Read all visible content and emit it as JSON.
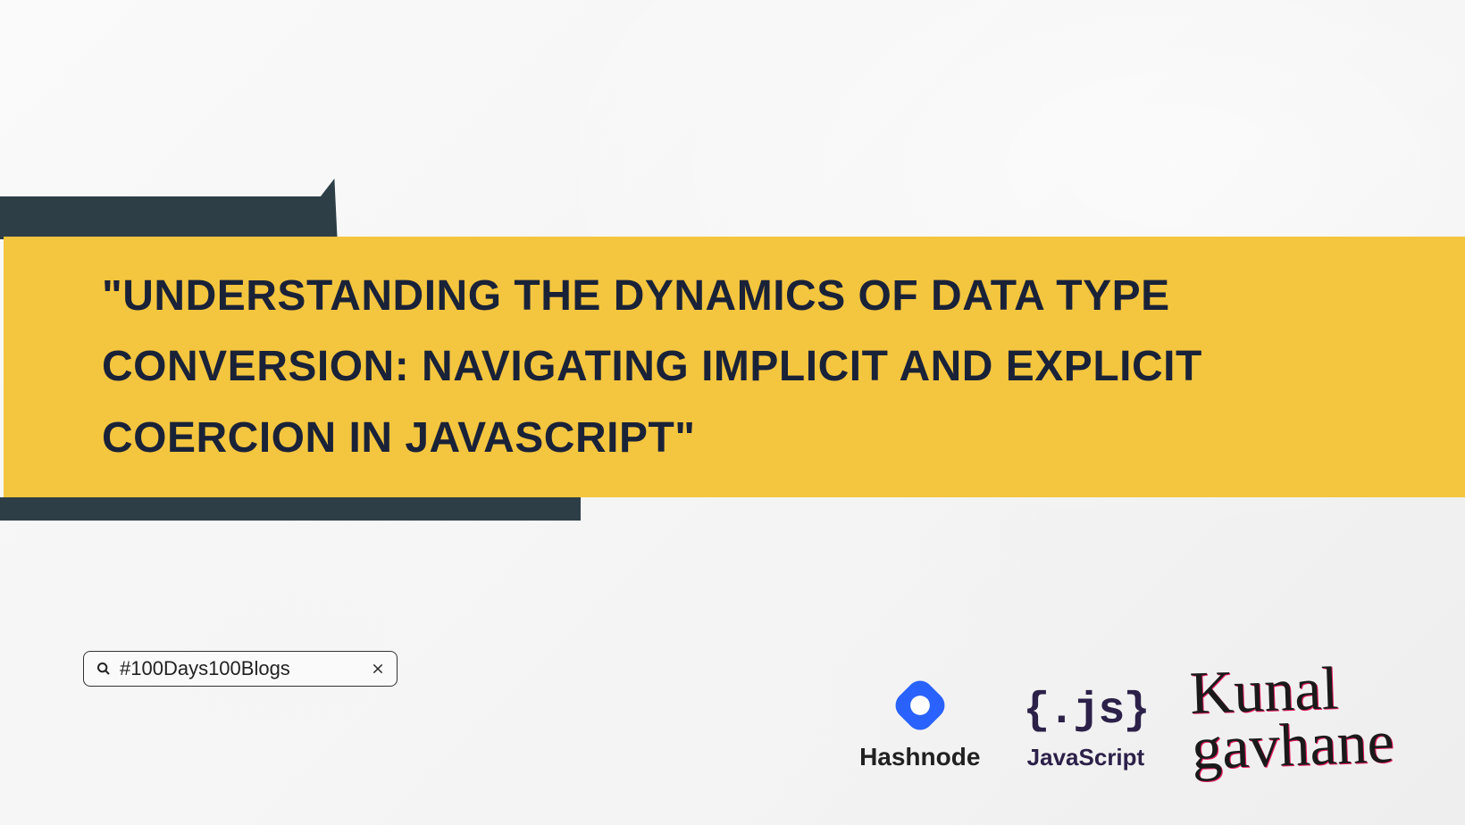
{
  "title": "\"UNDERSTANDING THE DYNAMICS OF DATA TYPE CONVERSION: NAVIGATING IMPLICIT AND EXPLICIT COERCION IN JAVASCRIPT\"",
  "search": {
    "text": "#100Days100Blogs"
  },
  "logos": {
    "hashnode": "Hashnode",
    "javascript_icon": "{.js}",
    "javascript_label": "JavaScript"
  },
  "signature": {
    "line1": "Kunal",
    "line2": "gavhane"
  }
}
